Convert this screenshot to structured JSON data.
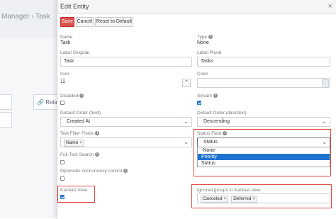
{
  "background": {
    "breadcrumb": "Manager › Task",
    "side_button_label": "Rela"
  },
  "modal": {
    "title": "Edit Entity",
    "close_glyph": "×",
    "buttons": {
      "save": "Save",
      "cancel": "Cancel",
      "reset": "Reset to Default"
    }
  },
  "fields": {
    "name": {
      "label": "Name",
      "value": "Task"
    },
    "type": {
      "label": "Type",
      "value": "None"
    },
    "label_singular": {
      "label": "Label Singular",
      "value": "Task"
    },
    "label_plural": {
      "label": "Label Plural",
      "value": "Tasks"
    },
    "icon": {
      "label": "Icon",
      "glyph": "☷",
      "button_glyph": "⌃"
    },
    "color": {
      "label": "Color"
    },
    "disabled": {
      "label": "Disabled",
      "checked": false
    },
    "stream": {
      "label": "Stream",
      "checked": true
    },
    "default_order_field": {
      "label": "Default Order (field)",
      "value": "Created At"
    },
    "default_order_direction": {
      "label": "Default Order (direction)",
      "value": "Descending"
    },
    "text_filter_fields": {
      "label": "Text Filter Fields",
      "tags": [
        "Name"
      ]
    },
    "status_field": {
      "label": "Status Field",
      "value": "Status",
      "options": [
        "-None-",
        "Priority",
        "Status"
      ],
      "selected_option": "Priority"
    },
    "full_text_search": {
      "label": "Full-Text Search",
      "checked": false
    },
    "optimistic_concurrency": {
      "label": "Optimistic concurrency control",
      "checked": false
    },
    "kanban_view": {
      "label": "Kanban View",
      "checked": true
    },
    "ignored_groups": {
      "label": "Ignored groups in Kanban view",
      "tags": [
        "Canceled",
        "Deferred"
      ]
    }
  },
  "glyphs": {
    "caret": "⌄",
    "tag_remove": "×",
    "info": "i"
  },
  "colors": {
    "save_button": "#d9534f",
    "highlight": "#e0453f",
    "selected_option": "#1e73d1"
  }
}
